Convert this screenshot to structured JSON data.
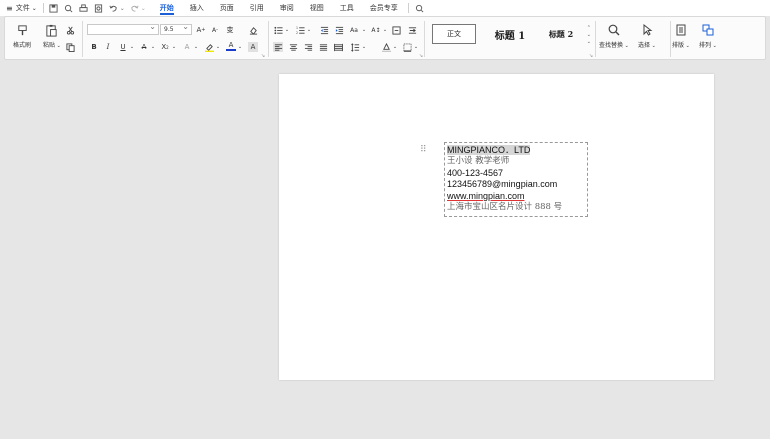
{
  "menubar": {
    "file_label": "文件",
    "tabs": [
      {
        "label": "开始",
        "active": true
      },
      {
        "label": "插入",
        "active": false
      },
      {
        "label": "页面",
        "active": false
      },
      {
        "label": "引用",
        "active": false
      },
      {
        "label": "审阅",
        "active": false
      },
      {
        "label": "视图",
        "active": false
      },
      {
        "label": "工具",
        "active": false
      },
      {
        "label": "会员专享",
        "active": false
      }
    ]
  },
  "ribbon": {
    "format_painter_label": "格式刷",
    "paste_label": "粘贴",
    "font_size": "9.5",
    "styles": {
      "normal": "正文",
      "heading1": "标题 1",
      "heading2": "标题 2"
    },
    "find_replace_label": "查找替换",
    "select_label": "选择",
    "layout_label": "排版",
    "arrange_label": "排列"
  },
  "document": {
    "card_lines": {
      "company": "MINGPIANCO．LTD",
      "name_title": "王小设   教学老师",
      "phone": "400-123-4567",
      "email": "123456789@mingpian.com",
      "website": "www.mingpian.com",
      "address": "上海市宝山区名片设计 888 号"
    }
  },
  "colors": {
    "accent": "#1a5fd8",
    "highlight_yellow": "#f2e500",
    "font_color_blue": "#1a3cc8"
  }
}
